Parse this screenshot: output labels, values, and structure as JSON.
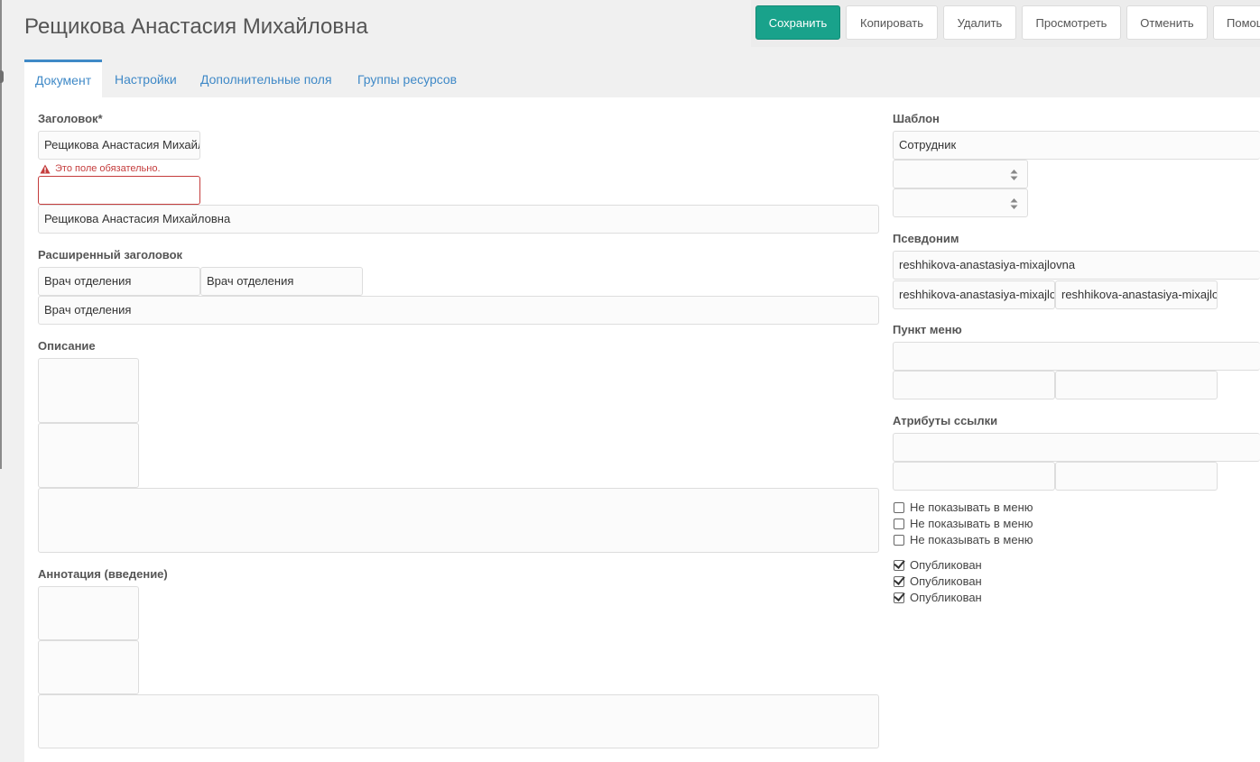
{
  "page": {
    "title": "Рещикова Анастасия Михайловна"
  },
  "toolbar": {
    "save": "Сохранить",
    "copy": "Копировать",
    "delete": "Удалить",
    "view": "Просмотреть",
    "cancel": "Отменить",
    "help": "Помощь"
  },
  "tabs": {
    "document": "Документ",
    "settings": "Настройки",
    "extra_fields": "Дополнительные поля",
    "resource_groups": "Группы ресурсов"
  },
  "form": {
    "title_label": "Заголовок*",
    "title_value": "Рещикова Анастасия Михайловна",
    "title_error": "Это поле обязательно.",
    "title_required_value": "",
    "title_full_value": "Рещикова Анастасия Михайловна",
    "longtitle_label": "Расширенный заголовок",
    "longtitle_value1": "Врач отделения",
    "longtitle_value2": "Врач отделения",
    "longtitle_value3": "Врач отделения",
    "description_label": "Описание",
    "introtext_label": "Аннотация (введение)"
  },
  "side": {
    "template_label": "Шаблон",
    "template_value": "Сотрудник",
    "alias_label": "Псевдоним",
    "alias_value": "reshhikova-anastasiya-mixajlovna",
    "alias_value2": "reshhikova-anastasiya-mixajlovna",
    "alias_value3": "reshhikova-anastasiya-mixajlovna",
    "menu_item_label": "Пункт меню",
    "link_attrs_label": "Атрибуты ссылки",
    "hide_menu_1": "Не показывать в меню",
    "hide_menu_2": "Не показывать в меню",
    "hide_menu_3": "Не показывать в меню",
    "published_1": "Опубликован",
    "published_2": "Опубликован",
    "published_3": "Опубликован"
  },
  "colors": {
    "primary": "#19a28b",
    "link": "#3f89c7",
    "error": "#c43c3c"
  }
}
